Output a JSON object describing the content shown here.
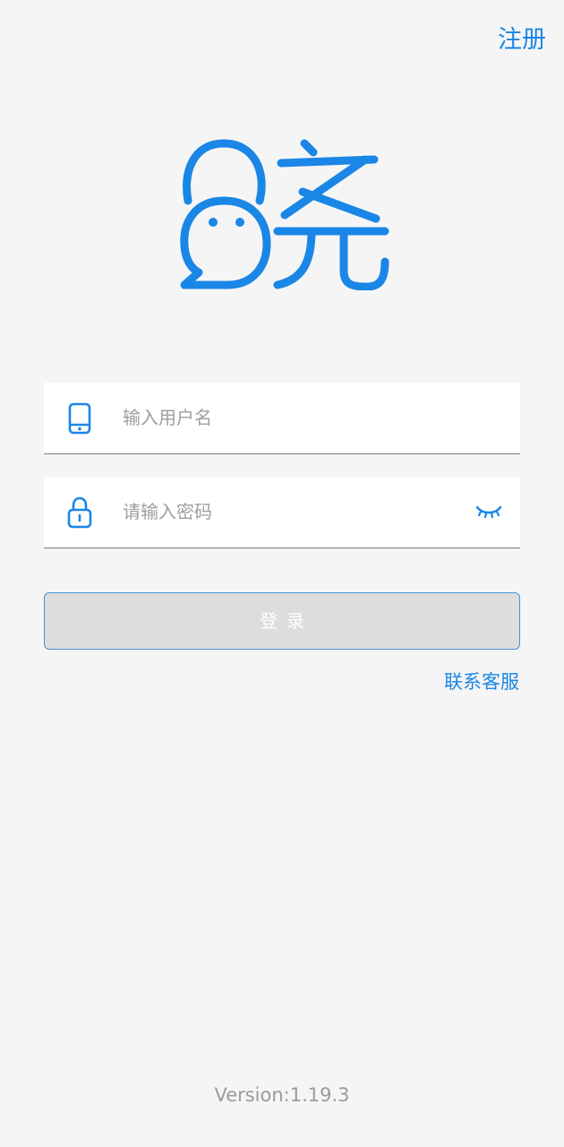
{
  "header": {
    "register_label": "注册"
  },
  "logo": {
    "icon": "xiao-chat-bubble-logo",
    "color": "#1a86e6"
  },
  "form": {
    "username": {
      "icon": "phone-icon",
      "placeholder": "输入用户名",
      "value": ""
    },
    "password": {
      "icon": "lock-icon",
      "placeholder": "请输入密码",
      "value": "",
      "toggle_icon": "eye-closed-icon"
    },
    "login_label": "登录"
  },
  "support": {
    "label": "联系客服"
  },
  "footer": {
    "version": "Version:1.19.3"
  },
  "colors": {
    "accent": "#1a86e6",
    "background": "#f5f5f5",
    "button_disabled": "#dddddd"
  }
}
